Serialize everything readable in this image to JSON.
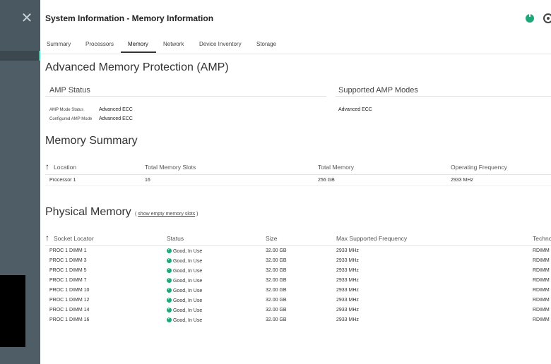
{
  "header": {
    "title": "System Information - Memory Information"
  },
  "tabs": [
    {
      "label": "Summary"
    },
    {
      "label": "Processors"
    },
    {
      "label": "Memory"
    },
    {
      "label": "Network"
    },
    {
      "label": "Device Inventory"
    },
    {
      "label": "Storage"
    }
  ],
  "amp": {
    "title": "Advanced Memory Protection (AMP)",
    "status_title": "AMP Status",
    "modes_title": "Supported AMP Modes",
    "mode_status_label": "AMP Mode Status",
    "mode_status_value": "Advanced ECC",
    "configured_label": "Configured AMP Mode",
    "configured_value": "Advanced ECC",
    "supported_mode": "Advanced ECC"
  },
  "summary": {
    "title": "Memory Summary",
    "headers": [
      "Location",
      "Total Memory Slots",
      "Total Memory",
      "Operating Frequency"
    ],
    "row": [
      "Processor 1",
      "16",
      "256 GB",
      "2933 MHz"
    ]
  },
  "physical": {
    "title": "Physical Memory",
    "link_open": "(",
    "link": "show empty memory slots",
    "link_close": ")",
    "headers": [
      "Socket Locator",
      "Status",
      "Size",
      "Max Supported Frequency",
      "Techno"
    ],
    "rows": [
      [
        "PROC 1 DIMM 1",
        "Good, In Use",
        "32.00 GB",
        "2933 MHz",
        "RDIMM"
      ],
      [
        "PROC 1 DIMM 3",
        "Good, In Use",
        "32.00 GB",
        "2933 MHz",
        "RDIMM"
      ],
      [
        "PROC 1 DIMM 5",
        "Good, In Use",
        "32.00 GB",
        "2933 MHz",
        "RDIMM"
      ],
      [
        "PROC 1 DIMM 7",
        "Good, In Use",
        "32.00 GB",
        "2933 MHz",
        "RDIMM"
      ],
      [
        "PROC 1 DIMM 10",
        "Good, In Use",
        "32.00 GB",
        "2933 MHz",
        "RDIMM"
      ],
      [
        "PROC 1 DIMM 12",
        "Good, In Use",
        "32.00 GB",
        "2933 MHz",
        "RDIMM"
      ],
      [
        "PROC 1 DIMM 14",
        "Good, In Use",
        "32.00 GB",
        "2933 MHz",
        "RDIMM"
      ],
      [
        "PROC 1 DIMM 16",
        "Good, In Use",
        "32.00 GB",
        "2933 MHz",
        "RDIMM"
      ]
    ]
  },
  "icons": {
    "close": "close-icon",
    "power": "power-icon",
    "settings": "settings-icon",
    "sort": "sort-ascending-icon",
    "status": "status-ok-icon"
  },
  "colors": {
    "sidebar": "#4a5862",
    "accent": "#2ad2a0",
    "ok": "#1fa77a"
  }
}
